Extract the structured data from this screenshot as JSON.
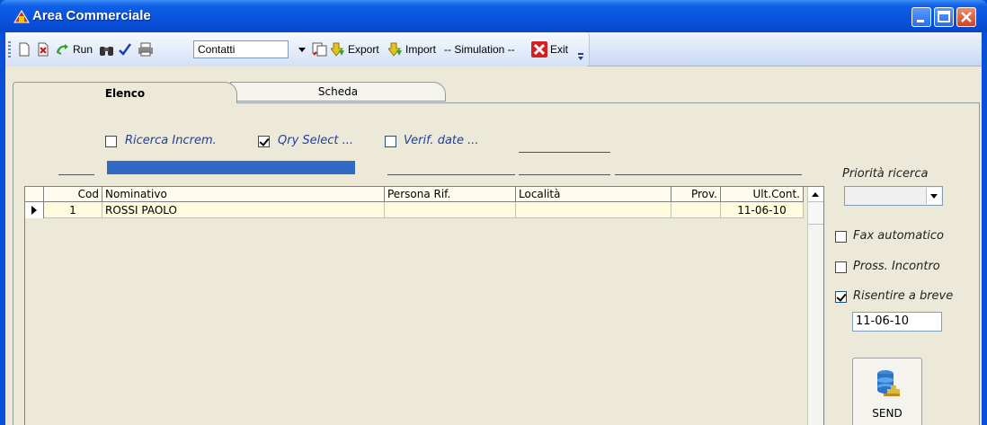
{
  "window": {
    "title": "Area Commerciale"
  },
  "toolbar": {
    "run_label": "Run",
    "combo_value": "Contatti",
    "export_label": "Export",
    "import_label": "Import",
    "simulation_label": "-- Simulation --",
    "exit_label": "Exit"
  },
  "tabs": [
    {
      "label": "Elenco",
      "active": true
    },
    {
      "label": "Scheda",
      "active": false
    }
  ],
  "filters": {
    "ricerca_increm": {
      "label": "Ricerca Increm.",
      "checked": false
    },
    "qry_select": {
      "label": "Qry Select ...",
      "checked": true
    },
    "verif_date": {
      "label": "Verif. date ...",
      "checked": false
    }
  },
  "grid": {
    "columns": [
      "Cod",
      "Nominativo",
      "Persona Rif.",
      "Località",
      "Prov.",
      "Ult.Cont."
    ],
    "rows": [
      {
        "cod": "1",
        "nominativo": "ROSSI PAOLO",
        "persona_rif": "",
        "localita": "",
        "prov": "",
        "ult_cont": "11-06-10"
      }
    ]
  },
  "sidebar": {
    "priorita_label": "Priorità ricerca",
    "priorita_value": "",
    "fax_automatico": {
      "label": "Fax automatico",
      "checked": false
    },
    "pross_incontro": {
      "label": "Pross. Incontro",
      "checked": false
    },
    "risentire_breve": {
      "label": "Risentire a breve",
      "checked": true
    },
    "risentire_date": "11-06-10",
    "send_label": "SEND"
  },
  "colors": {
    "titlebar": "#0a52dc",
    "panel": "#ece9d8",
    "selection_bar": "#316ac5",
    "row_bg": "#fffbdc"
  }
}
